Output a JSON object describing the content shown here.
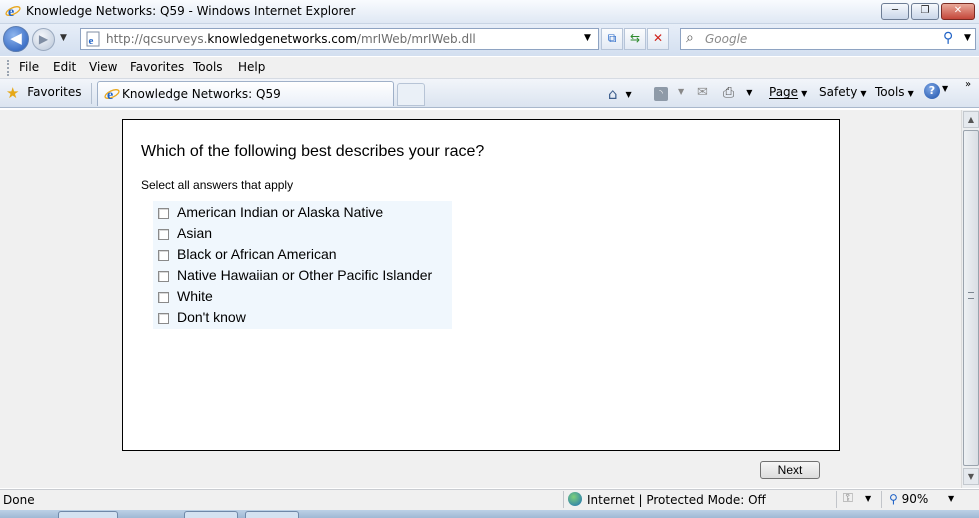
{
  "window": {
    "title": "Knowledge Networks: Q59 - Windows Internet Explorer",
    "minimize_glyph": "─",
    "restore_glyph": "❐",
    "close_glyph": "✕"
  },
  "address": {
    "url_prefix": "http://qcsurveys.",
    "url_domain": "knowledgenetworks.com",
    "url_path": "/mrIWeb/mrIWeb.dll"
  },
  "search": {
    "placeholder": "Google"
  },
  "menu": {
    "file": "File",
    "edit": "Edit",
    "view": "View",
    "favorites": "Favorites",
    "tools": "Tools",
    "help": "Help"
  },
  "favbar": {
    "favorites_label": "Favorites",
    "tab_title": "Knowledge Networks: Q59"
  },
  "commandbar": {
    "page": "Page",
    "safety": "Safety",
    "tools": "Tools"
  },
  "survey": {
    "question": "Which of the following best describes your race?",
    "instruction": "Select all answers that apply",
    "options": [
      "American Indian or Alaska Native",
      "Asian",
      "Black or African American",
      "Native Hawaiian or Other Pacific Islander",
      "White",
      "Don't know"
    ],
    "next_label": "Next"
  },
  "status": {
    "left": "Done",
    "zone": "Internet | Protected Mode: Off",
    "zoom": "90%"
  },
  "colors": {
    "ie_blue": "#1f62c6",
    "options_bg": "#f0f7fd"
  }
}
